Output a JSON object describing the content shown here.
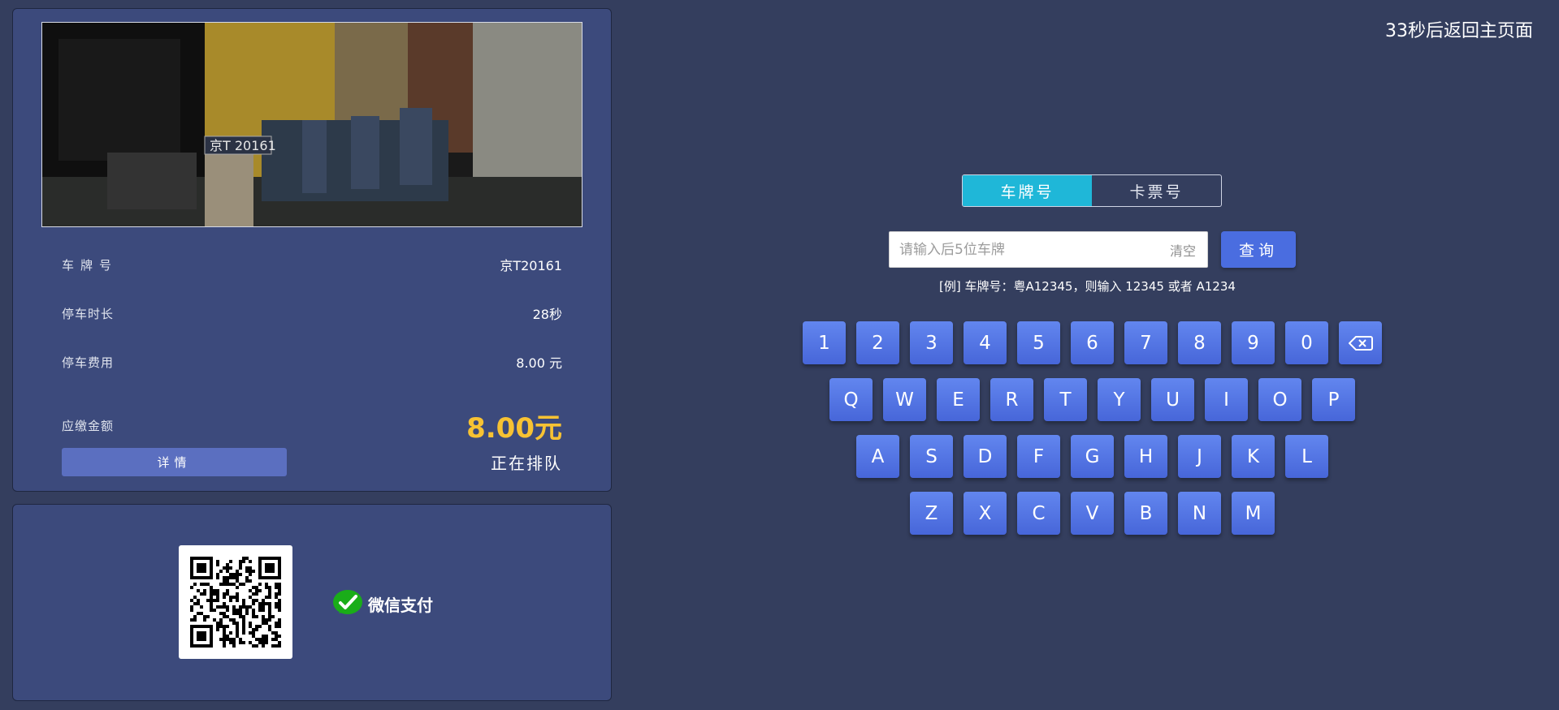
{
  "header": {
    "countdown": "33秒后返回主页面"
  },
  "info": {
    "plate_label": "车牌号",
    "plate_value": "京T20161",
    "duration_label": "停车时长",
    "duration_value": "28秒",
    "fee_label": "停车费用",
    "fee_value": "8.00 元",
    "due_label": "应缴金额",
    "due_value": "8.00元",
    "detail_button": "详情",
    "queue_status": "正在排队"
  },
  "payment": {
    "method": "微信支付",
    "icon": "wechat-pay-icon"
  },
  "search": {
    "tabs": [
      {
        "label": "车牌号",
        "active": true
      },
      {
        "label": "卡票号",
        "active": false
      }
    ],
    "placeholder": "请输入后5位车牌",
    "value": "",
    "clear_label": "清空",
    "query_label": "查询",
    "hint": "[例] 车牌号：粤A12345，则输入 12345 或者 A1234"
  },
  "keyboard": {
    "rows": [
      [
        "1",
        "2",
        "3",
        "4",
        "5",
        "6",
        "7",
        "8",
        "9",
        "0",
        "⌫"
      ],
      [
        "Q",
        "W",
        "E",
        "R",
        "T",
        "Y",
        "U",
        "I",
        "O",
        "P"
      ],
      [
        "A",
        "S",
        "D",
        "F",
        "G",
        "H",
        "J",
        "K",
        "L"
      ],
      [
        "Z",
        "X",
        "C",
        "V",
        "B",
        "N",
        "M"
      ]
    ],
    "backspace_icon": "backspace-icon"
  },
  "colors": {
    "background": "#343e5e",
    "panel": "#3c4a7c",
    "key": "#5072e3",
    "active_tab": "#1fb7d8",
    "amount": "#f7c233"
  }
}
